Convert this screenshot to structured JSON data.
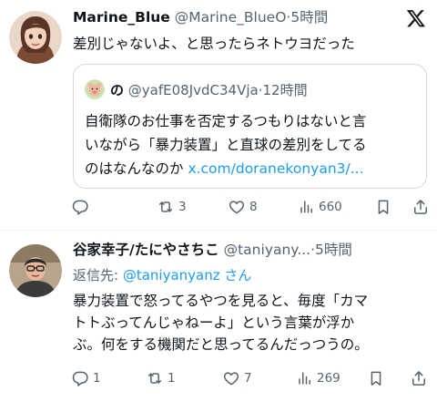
{
  "post1": {
    "name": "Marine_Blue",
    "handle": "@Marine_BlueO",
    "dot": "·",
    "time": "5時間",
    "text": "差別じゃないよ、と思ったらネトウヨだった",
    "quote": {
      "name": "の",
      "handle": "@yafE08JvdC34Vja",
      "dot": "·",
      "time": "12時間",
      "line1": "自衛隊のお仕事を否定するつもりはないと言",
      "line2": "いながら「暴力装置」と直球の差別をしてる",
      "line3_text": "のはなんなのか ",
      "line3_link": "x.com/doranekonyan3/..."
    },
    "actions": {
      "reply": "",
      "retweet": "3",
      "like": "8",
      "views": "660"
    }
  },
  "post2": {
    "name": "谷家幸子/たにやさちこ",
    "handle": "@taniyany...",
    "dot": "·",
    "time": "5時間",
    "reply_prefix": "返信先: ",
    "reply_mention": "@taniyanyanz",
    "reply_suffix": " さん",
    "line1": "暴力装置で怒ってるやつを見ると、毎度「カマ",
    "line2": "トトぶってんじゃねーよ」という言葉が浮か",
    "line3": "ぶ。何をする機関だと思ってるんだっつうの。",
    "actions": {
      "reply": "1",
      "retweet": "1",
      "like": "7",
      "views": "269"
    }
  },
  "icons": [
    "x-logo-icon",
    "reply-icon",
    "retweet-icon",
    "like-icon",
    "views-icon",
    "bookmark-icon",
    "share-icon"
  ],
  "colors": {
    "link": "#1d9bf0",
    "secondary": "#536471",
    "border": "#cfd9de"
  }
}
